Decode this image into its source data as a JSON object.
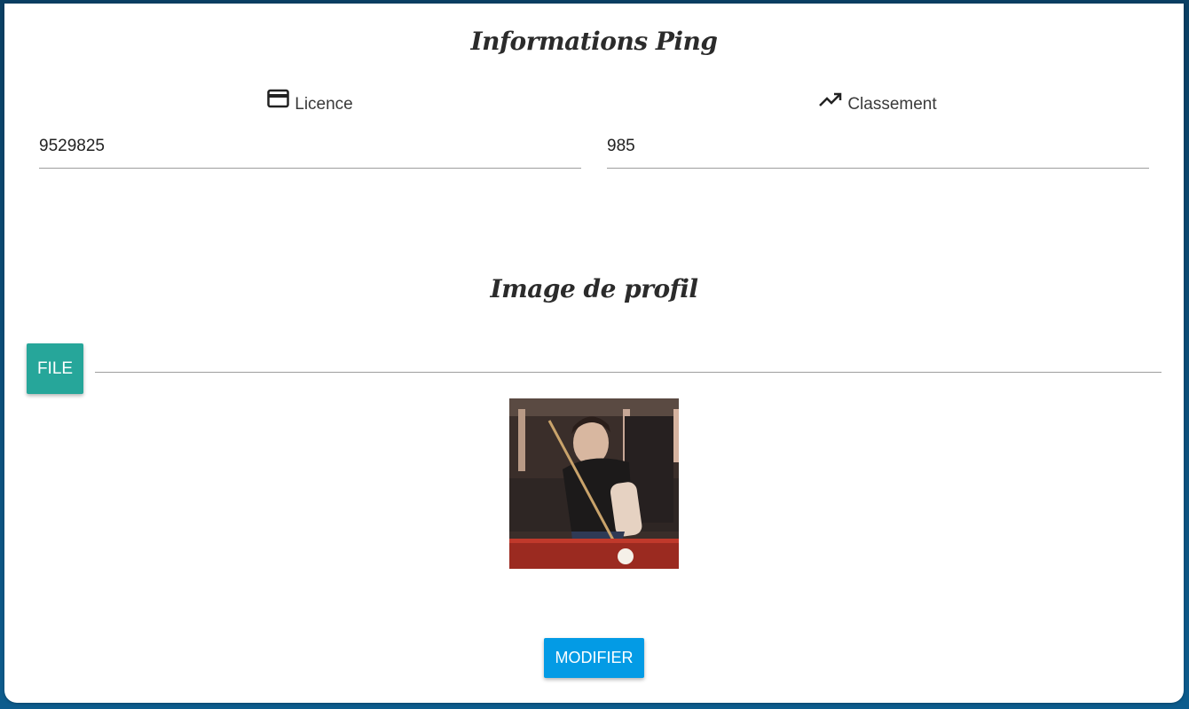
{
  "sections": {
    "info_title": "Informations Ping",
    "image_title": "Image de profil"
  },
  "licence": {
    "label": "Licence",
    "icon": "credit-card-icon",
    "value": "9529825"
  },
  "classement": {
    "label": "Classement",
    "icon": "trending-up-icon",
    "value": "985"
  },
  "file_input": {
    "button_label": "FILE",
    "path_value": ""
  },
  "profile_image": {
    "description": "profile-photo"
  },
  "actions": {
    "submit_label": "MODIFIER"
  },
  "colors": {
    "file_button": "#26a69a",
    "submit_button": "#039be5",
    "background": "#0b4f7a"
  }
}
